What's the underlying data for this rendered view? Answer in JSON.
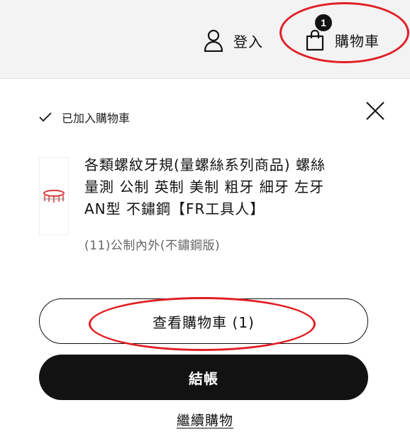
{
  "header": {
    "login_label": "登入",
    "cart_label": "購物車",
    "cart_count": "1"
  },
  "notification": {
    "added_text": "已加入購物車",
    "check_icon": "check-icon",
    "close_icon": "close-icon"
  },
  "product": {
    "title_line1": "各類螺紋牙規(量螺絲系列商品) 螺絲",
    "title_line2": "量測 公制 英制 美制 粗牙 細牙 左牙",
    "title_line3": "AN型 不鏽鋼【FR工具人】",
    "variant": "(11)公制內外(不鏽鋼版)"
  },
  "actions": {
    "view_cart_label": "查看購物車 (1)",
    "checkout_label": "結帳",
    "continue_label": "繼續購物"
  },
  "colors": {
    "header_bg": "#f3f3f3",
    "primary": "#121212",
    "annotation": "#e01f25"
  }
}
